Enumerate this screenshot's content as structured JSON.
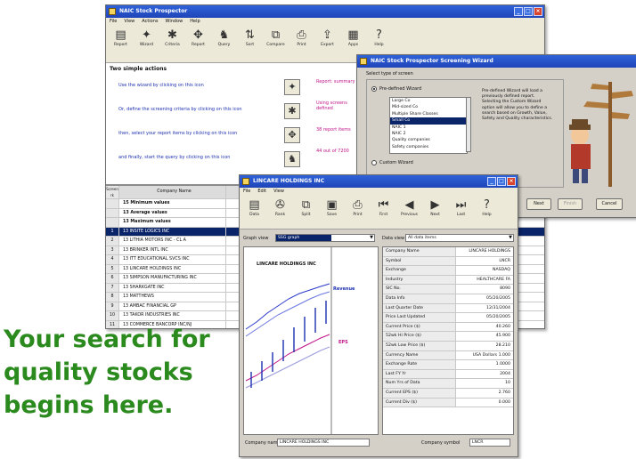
{
  "main_window": {
    "title": "NAIC Stock Prospector",
    "menu": [
      "File",
      "View",
      "Actions",
      "Window",
      "Help"
    ],
    "toolbar": [
      {
        "label": "Report",
        "icon": "report-icon",
        "glyph": "▤"
      },
      {
        "label": "Wizard",
        "icon": "wizard-icon",
        "glyph": "✦"
      },
      {
        "label": "Criteria",
        "icon": "criteria-icon",
        "glyph": "✱"
      },
      {
        "label": "Report",
        "icon": "report-settings-icon",
        "glyph": "✥"
      },
      {
        "label": "Query",
        "icon": "query-icon",
        "glyph": "♞"
      },
      {
        "label": "Sort",
        "icon": "sort-icon",
        "glyph": "⇅"
      },
      {
        "label": "Compare",
        "icon": "compare-icon",
        "glyph": "⧉"
      },
      {
        "label": "Print",
        "icon": "print-icon",
        "glyph": "⎙"
      },
      {
        "label": "Export",
        "icon": "export-icon",
        "glyph": "⇪"
      },
      {
        "label": "Apps",
        "icon": "apps-icon",
        "glyph": "▦"
      },
      {
        "label": "Help",
        "icon": "help-icon",
        "glyph": "?"
      }
    ],
    "panel_title": "Two simple actions",
    "steps": [
      {
        "text": "Use the wizard by clicking on this icon",
        "icon": "wizard-icon",
        "glyph": "✦"
      },
      {
        "text": "Or, define the screening criteria by clicking on this icon",
        "icon": "criteria-icon",
        "glyph": "✱"
      },
      {
        "text": "then, select your report items by clicking on this icon",
        "icon": "report-icon",
        "glyph": "✥"
      },
      {
        "text": "and finally, start the query by clicking on this icon",
        "icon": "query-icon",
        "glyph": "♞"
      }
    ],
    "right_notes": [
      "Report: summary",
      "Using screens defined",
      "38 report items",
      "44 out of 7200"
    ],
    "grid": {
      "headers": [
        "Screen rk",
        "Company Name"
      ],
      "summary_rows": [
        {
          "rank": "",
          "name": "15 Minimum values"
        },
        {
          "rank": "",
          "name": "13 Average values"
        },
        {
          "rank": "",
          "name": "13 Maximum values"
        }
      ],
      "rows": [
        {
          "rank": "1",
          "name": "13 INSITE LOGICS INC",
          "selected": true
        },
        {
          "rank": "2",
          "name": "13 LITHIA MOTORS INC - CL A",
          "selected": false
        },
        {
          "rank": "3",
          "name": "13 BRINKER INTL INC",
          "selected": false
        },
        {
          "rank": "4",
          "name": "13 ITT EDUCATIONAL SVCS INC",
          "selected": false
        },
        {
          "rank": "5",
          "name": "13 LINCARE HOLDINGS INC",
          "selected": false
        },
        {
          "rank": "6",
          "name": "13 SIMPSON MANUFACTURING INC",
          "selected": false
        },
        {
          "rank": "7",
          "name": "13 SHARKGATE INC",
          "selected": false
        },
        {
          "rank": "8",
          "name": "13 MATTHEWS",
          "selected": false
        },
        {
          "rank": "9",
          "name": "13 AMBAC FINANCIAL GP",
          "selected": false
        },
        {
          "rank": "10",
          "name": "13 TAKOR INDUSTRIES INC",
          "selected": false
        },
        {
          "rank": "11",
          "name": "13 COMMERCE BANCORP INC/NJ",
          "selected": false
        }
      ]
    }
  },
  "wizard": {
    "title": "NAIC Stock Prospector Screening Wizard",
    "group_label": "Select type of screen",
    "options": [
      {
        "label": "Pre-defined Wizard",
        "checked": true
      },
      {
        "label": "Custom Wizard",
        "checked": false
      }
    ],
    "screens": [
      "Large Co",
      "Mid-sized Co",
      "Multiple Share Classes",
      "Small Co",
      "NAIC 1",
      "NAIC 2",
      "Quality companies",
      "Safety companies"
    ],
    "selected_screen_index": 3,
    "description": "Pre-defined Wizard will load a previously defined report. Selecting the Custom Wizard option will allow you to define a search based on Growth, Value, Safety and Quality characteristics.",
    "buttons": {
      "next": "Next",
      "finish": "Finish",
      "cancel": "Cancel"
    }
  },
  "company_window": {
    "title": "LINCARE HOLDINGS INC",
    "menu": [
      "File",
      "Edit",
      "View"
    ],
    "toolbar": [
      {
        "label": "Data",
        "icon": "data-icon",
        "glyph": "▤"
      },
      {
        "label": "Rank",
        "icon": "rank-icon",
        "glyph": "✇"
      },
      {
        "label": "Split",
        "icon": "split-icon",
        "glyph": "⧉"
      },
      {
        "label": "Save",
        "icon": "save-icon",
        "glyph": "▣"
      },
      {
        "label": "Print",
        "icon": "print-icon",
        "glyph": "⎙"
      },
      {
        "label": "First",
        "icon": "first-icon",
        "glyph": "⏮"
      },
      {
        "label": "Previous",
        "icon": "previous-icon",
        "glyph": "◀"
      },
      {
        "label": "Next",
        "icon": "next-icon",
        "glyph": "▶"
      },
      {
        "label": "Last",
        "icon": "last-icon",
        "glyph": "⏭"
      },
      {
        "label": "Help",
        "icon": "help-icon",
        "glyph": "?"
      }
    ],
    "graph_view_label": "Graph view",
    "graph_view_value": "SSG graph",
    "data_view_label": "Data view",
    "data_view_value": "All data items",
    "graph_title": "LINCARE HOLDINGS INC",
    "revenue_label": "Revenue",
    "eps_label": "EPS",
    "fields": [
      {
        "label": "Company Name",
        "value": "LINCARE HOLDINGS"
      },
      {
        "label": "Symbol",
        "value": "LNCR"
      },
      {
        "label": "Exchange",
        "value": "NASDAQ"
      },
      {
        "label": "Industry",
        "value": "HEALTHCARE FA"
      },
      {
        "label": "SIC No.",
        "value": "8090"
      },
      {
        "label": "Data Info",
        "value": "05/20/2005"
      },
      {
        "label": "Last Quarter Date",
        "value": "12/31/2004"
      },
      {
        "label": "Price Last Updated",
        "value": "05/20/2005"
      },
      {
        "label": "Current Price ($)",
        "value": "40.260"
      },
      {
        "label": "52wk Hi Price ($)",
        "value": "45.900"
      },
      {
        "label": "52wk Low Price ($)",
        "value": "28.210"
      },
      {
        "label": "Currency Name",
        "value": "USA Dollars  1.000"
      },
      {
        "label": "Exchange Rate",
        "value": "1.0000"
      },
      {
        "label": "Last FY Yr",
        "value": "2004"
      },
      {
        "label": "Num Yrs of Data",
        "value": "10"
      },
      {
        "label": "Current EPS ($)",
        "value": "2.760"
      },
      {
        "label": "Current Div ($)",
        "value": "0.000"
      }
    ],
    "company_name_label": "Company name",
    "company_name_value": "LINCARE HOLDINGS INC",
    "symbol_label": "Company symbol",
    "symbol_value": "LNCR"
  },
  "tagline": [
    "Your search for",
    "quality stocks",
    "begins here."
  ],
  "colors": {
    "title_blue": "#1f45b8",
    "link_blue": "#1c2fb0",
    "note_magenta": "#c0148a",
    "tagline_green": "#2b8a1d",
    "selected_row": "#0a246a"
  }
}
